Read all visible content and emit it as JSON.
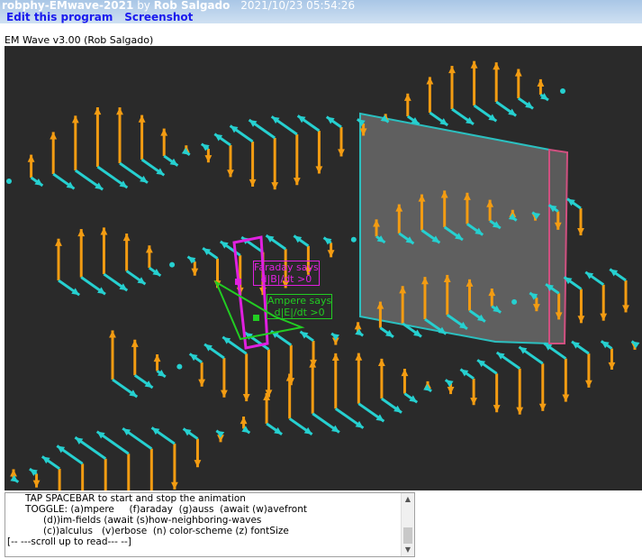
{
  "header": {
    "project": "robphy-EMwave-2021",
    "by": "by",
    "author": "Rob Salgado",
    "timestamp": "2021/10/23 05:54:26",
    "links": [
      {
        "label": "Edit this program"
      },
      {
        "label": "Screenshot"
      }
    ]
  },
  "program_title": "EM Wave v3.00 (Rob Salgado)",
  "scene": {
    "faraday_label": "Faraday says\nd|B|/dt >0",
    "ampere_label": "Ampere says\nd|E|/dt >0",
    "colors": {
      "background": "#2a2a2a",
      "e_field": "#f39c12",
      "b_field": "#26d0d0",
      "faraday": "#e020e0",
      "ampere": "#22cc22",
      "wavefront": "#8a8a8a"
    }
  },
  "console": {
    "lines": [
      "      TAP SPACEBAR to start and stop the animation",
      "      TOGGLE: (a)mpere     (f)araday  (g)auss  (await (w)avefront",
      "            (d))im-fields (await (s)how-neighboring-waves",
      "            (c))alculus   (v)erbose  (n) color-scheme (z) fontSize",
      "[-- ---scroll up to read--- --]"
    ]
  }
}
